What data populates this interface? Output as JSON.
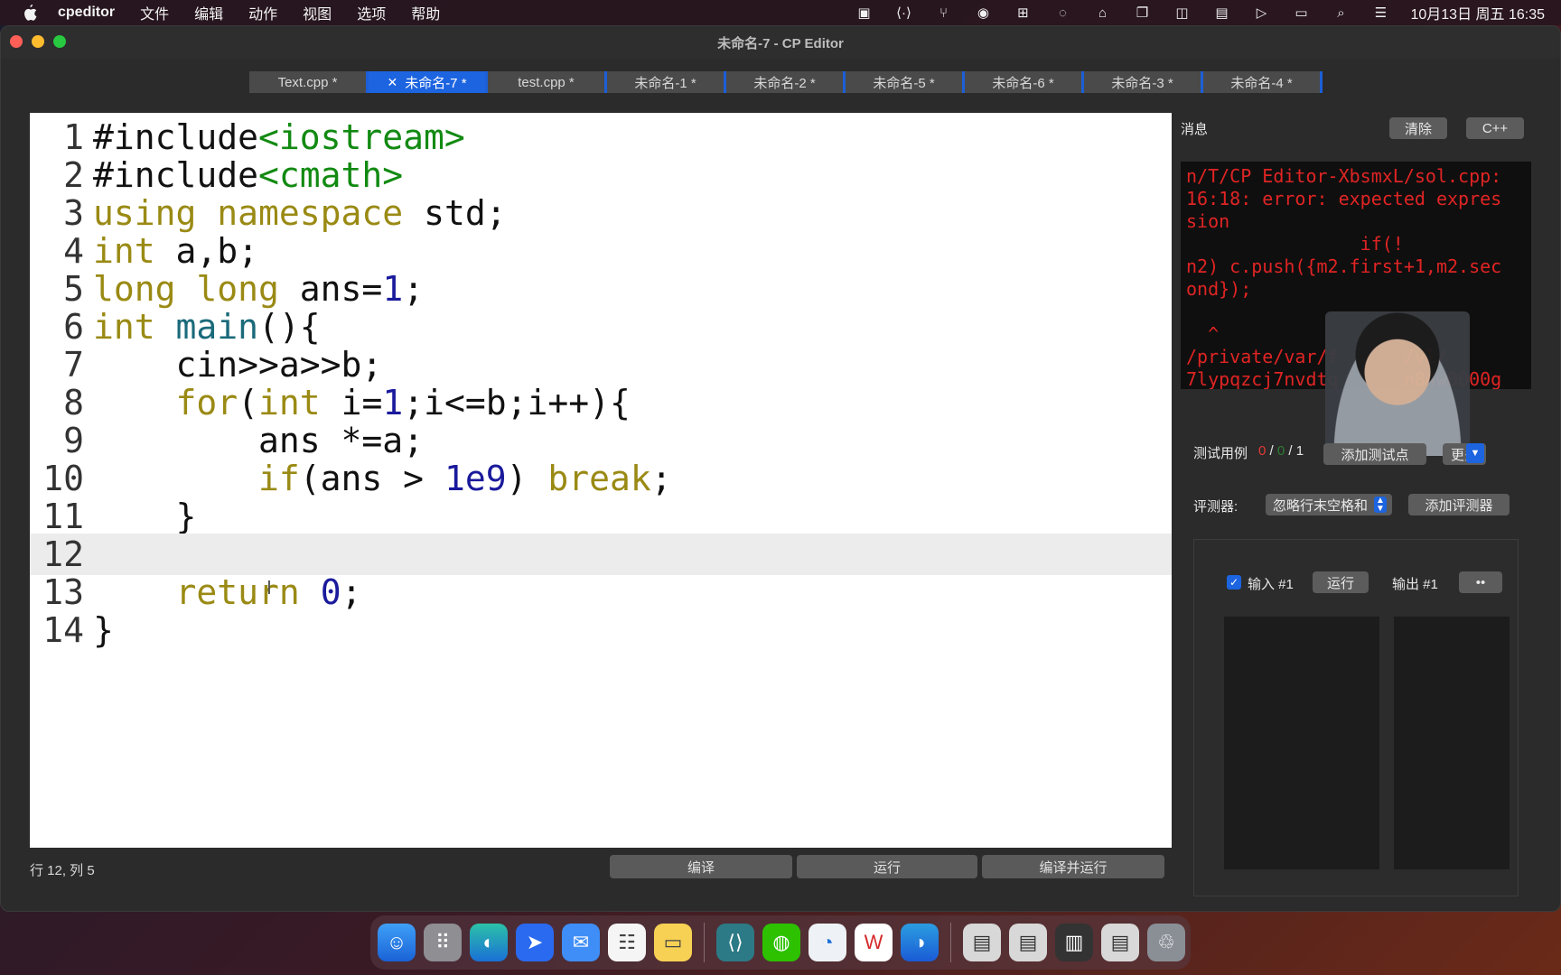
{
  "menubar": {
    "app_name": "cpeditor",
    "items": [
      "文件",
      "编辑",
      "动作",
      "视图",
      "选项",
      "帮助"
    ],
    "clock": "10月13日 周五 16:35"
  },
  "window": {
    "title": "未命名-7 - CP Editor"
  },
  "tabs": [
    {
      "label": "Text.cpp *",
      "active": false
    },
    {
      "label": "未命名-7 *",
      "active": true
    },
    {
      "label": "test.cpp *",
      "active": false
    },
    {
      "label": "未命名-1 *",
      "active": false
    },
    {
      "label": "未命名-2 *",
      "active": false
    },
    {
      "label": "未命名-5 *",
      "active": false
    },
    {
      "label": "未命名-6 *",
      "active": false
    },
    {
      "label": "未命名-3 *",
      "active": false
    },
    {
      "label": "未命名-4 *",
      "active": false
    }
  ],
  "editor": {
    "line_numbers": [
      "1",
      "2",
      "3",
      "4",
      "5",
      "6",
      "7",
      "8",
      "9",
      "10",
      "11",
      "12",
      "13",
      "14"
    ],
    "current_line": "12"
  },
  "status": {
    "cursor_position": "行 12, 列 5"
  },
  "bottom_buttons": {
    "compile": "编译",
    "run": "运行",
    "compile_run": "编译并运行"
  },
  "right_panel": {
    "messages_label": "消息",
    "clear_button": "清除",
    "lang_button": "C++",
    "messages_text": "n/T/CP Editor-XbsmxL/sol.cpp:\n16:18: error: expected expres\nsion\n                if(!\nn2) c.push({m2.first+1,m2.sec\nond});\n\n  ^\n/private/var/f      /vl/\n7lypqzcj7nvdtq      n84w0000g",
    "tests_label": "测试用例",
    "tests_fail": "0",
    "tests_pass": "0",
    "tests_total": "1",
    "add_test_button": "添加测试点",
    "more_button": "更多",
    "judge_label": "评测器:",
    "judge_value": "忽略行末空格和",
    "add_judge_button": "添加评测器",
    "input_label": "输入 #1",
    "run_button": "运行",
    "output_label": "输出 #1",
    "output_menu": "••"
  },
  "dock": {
    "apps": [
      "finder-icon",
      "launchpad-icon",
      "edge-icon",
      "lark-icon",
      "mail-icon",
      "reminders-icon",
      "notes-icon",
      "vscode-remote-icon",
      "wechat-icon",
      "qq-icon",
      "wps-icon",
      "edge-beta-icon",
      "window-1-icon",
      "window-2-icon",
      "window-3-icon",
      "window-4-icon",
      "trash-icon"
    ]
  },
  "colors": {
    "tab_active": "#1c64e0",
    "keyword": "#9a8a14",
    "number": "#1a1a9c",
    "string": "#128a12",
    "error_text": "#e02424"
  }
}
